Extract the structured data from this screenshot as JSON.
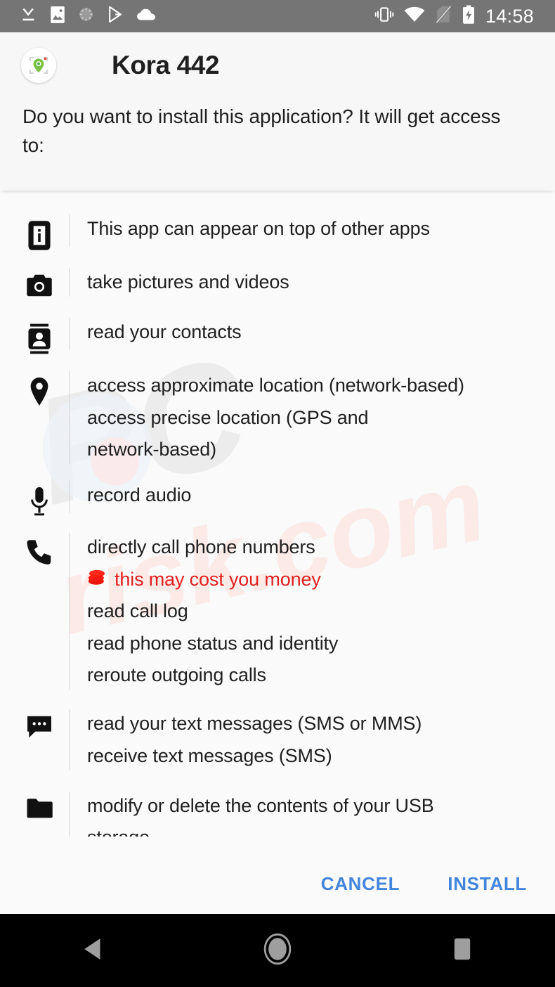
{
  "status_bar": {
    "background": "#757575",
    "time": "14:58",
    "left_icons": [
      {
        "name": "download-complete-icon"
      },
      {
        "name": "screenshot-image-icon"
      },
      {
        "name": "sync-spinner-icon"
      },
      {
        "name": "play-store-icon"
      },
      {
        "name": "cloud-icon"
      }
    ],
    "right_icons": [
      {
        "name": "vibrate-mode-icon"
      },
      {
        "name": "wifi-icon"
      },
      {
        "name": "no-sim-card-icon"
      },
      {
        "name": "battery-charging-icon"
      }
    ]
  },
  "dialog": {
    "app_name": "Kora 442",
    "app_icon": "kora-app-icon",
    "message": "Do you want to install this application? It will get access to:",
    "watermark_text": "pcrisk.com",
    "permissions": [
      {
        "icon": "app-overlay-icon",
        "lines": [
          {
            "text": "This app can appear on top of other apps",
            "warning": false
          }
        ]
      },
      {
        "icon": "camera-icon",
        "lines": [
          {
            "text": "take pictures and videos",
            "warning": false
          }
        ]
      },
      {
        "icon": "contacts-icon",
        "lines": [
          {
            "text": "read your contacts",
            "warning": false
          }
        ]
      },
      {
        "icon": "location-pin-icon",
        "lines": [
          {
            "text": "access approximate location (network-based)",
            "warning": false
          },
          {
            "text": "access precise location (GPS and network-based)",
            "warning": false
          }
        ]
      },
      {
        "icon": "microphone-icon",
        "lines": [
          {
            "text": "record audio",
            "warning": false
          }
        ]
      },
      {
        "icon": "phone-call-icon",
        "lines": [
          {
            "text": "directly call phone numbers",
            "warning": false
          },
          {
            "text": "this may cost you money",
            "warning": true
          },
          {
            "text": "read call log",
            "warning": false
          },
          {
            "text": "read phone status and identity",
            "warning": false
          },
          {
            "text": "reroute outgoing calls",
            "warning": false
          }
        ]
      },
      {
        "icon": "sms-message-icon",
        "lines": [
          {
            "text": "read your text messages (SMS or MMS)",
            "warning": false
          },
          {
            "text": "receive text messages (SMS)",
            "warning": false
          }
        ]
      },
      {
        "icon": "folder-storage-icon",
        "lines": [
          {
            "text": "modify or delete the contents of your USB",
            "warning": false
          },
          {
            "text": "storage",
            "warning": false
          }
        ]
      }
    ],
    "buttons": {
      "cancel_label": "CANCEL",
      "install_label": "INSTALL",
      "accent_color": "#4285dc"
    },
    "warning_color": "#e02020"
  },
  "nav_bar": {
    "background": "#000000",
    "buttons": [
      {
        "name": "nav-back-button"
      },
      {
        "name": "nav-home-button"
      },
      {
        "name": "nav-recents-button"
      }
    ]
  }
}
